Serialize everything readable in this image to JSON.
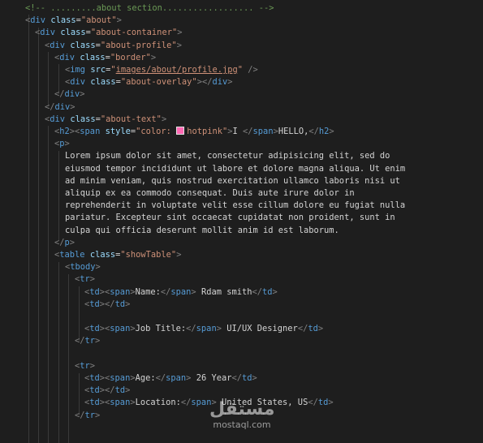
{
  "editor": {
    "lines": [
      [
        {
          "t": "<!-- .........about section.................. -->",
          "c": "comment"
        }
      ],
      [
        {
          "t": "<",
          "c": "punc"
        },
        {
          "t": "div",
          "c": "tag"
        },
        {
          "t": " "
        },
        {
          "t": "class",
          "c": "attr"
        },
        {
          "t": "=",
          "c": "text"
        },
        {
          "t": "\"about\"",
          "c": "str"
        },
        {
          "t": ">",
          "c": "punc"
        }
      ],
      [
        {
          "t": "<",
          "c": "punc"
        },
        {
          "t": "div",
          "c": "tag"
        },
        {
          "t": " "
        },
        {
          "t": "class",
          "c": "attr"
        },
        {
          "t": "=",
          "c": "text"
        },
        {
          "t": "\"about-container\"",
          "c": "str"
        },
        {
          "t": ">",
          "c": "punc"
        }
      ],
      [
        {
          "t": "<",
          "c": "punc"
        },
        {
          "t": "div",
          "c": "tag"
        },
        {
          "t": " "
        },
        {
          "t": "class",
          "c": "attr"
        },
        {
          "t": "=",
          "c": "text"
        },
        {
          "t": "\"about-profile\"",
          "c": "str"
        },
        {
          "t": ">",
          "c": "punc"
        }
      ],
      [
        {
          "t": "<",
          "c": "punc"
        },
        {
          "t": "div",
          "c": "tag"
        },
        {
          "t": " "
        },
        {
          "t": "class",
          "c": "attr"
        },
        {
          "t": "=",
          "c": "text"
        },
        {
          "t": "\"border\"",
          "c": "str"
        },
        {
          "t": ">",
          "c": "punc"
        }
      ],
      [
        {
          "t": "<",
          "c": "punc"
        },
        {
          "t": "img",
          "c": "tag"
        },
        {
          "t": " "
        },
        {
          "t": "src",
          "c": "attr"
        },
        {
          "t": "=",
          "c": "text"
        },
        {
          "t": "\"",
          "c": "str"
        },
        {
          "t": "images/about/profile.jpg",
          "c": "str",
          "u": true
        },
        {
          "t": "\"",
          "c": "str"
        },
        {
          "t": " "
        },
        {
          "t": "/>",
          "c": "punc"
        }
      ],
      [
        {
          "t": "<",
          "c": "punc"
        },
        {
          "t": "div",
          "c": "tag"
        },
        {
          "t": " "
        },
        {
          "t": "class",
          "c": "attr"
        },
        {
          "t": "=",
          "c": "text"
        },
        {
          "t": "\"about-overlay\"",
          "c": "str"
        },
        {
          "t": "></",
          "c": "punc"
        },
        {
          "t": "div",
          "c": "tag"
        },
        {
          "t": ">",
          "c": "punc"
        }
      ],
      [
        {
          "t": "</",
          "c": "punc"
        },
        {
          "t": "div",
          "c": "tag"
        },
        {
          "t": ">",
          "c": "punc"
        }
      ],
      [
        {
          "t": "</",
          "c": "punc"
        },
        {
          "t": "div",
          "c": "tag"
        },
        {
          "t": ">",
          "c": "punc"
        }
      ],
      [
        {
          "t": "<",
          "c": "punc"
        },
        {
          "t": "div",
          "c": "tag"
        },
        {
          "t": " "
        },
        {
          "t": "class",
          "c": "attr"
        },
        {
          "t": "=",
          "c": "text"
        },
        {
          "t": "\"about-text\"",
          "c": "str"
        },
        {
          "t": ">",
          "c": "punc"
        }
      ],
      [
        {
          "t": "<",
          "c": "punc"
        },
        {
          "t": "h2",
          "c": "tag"
        },
        {
          "t": "><",
          "c": "punc"
        },
        {
          "t": "span",
          "c": "tag"
        },
        {
          "t": " "
        },
        {
          "t": "style",
          "c": "attr"
        },
        {
          "t": "=",
          "c": "text"
        },
        {
          "t": "\"color: ",
          "c": "str"
        },
        {
          "t": "hotpink",
          "c": "str",
          "sw": "#ff69b4"
        },
        {
          "t": "\"",
          "c": "str"
        },
        {
          "t": ">",
          "c": "punc"
        },
        {
          "t": "I ",
          "c": "text"
        },
        {
          "t": "</",
          "c": "punc"
        },
        {
          "t": "span",
          "c": "tag"
        },
        {
          "t": ">",
          "c": "punc"
        },
        {
          "t": "HELLO,",
          "c": "text"
        },
        {
          "t": "</",
          "c": "punc"
        },
        {
          "t": "h2",
          "c": "tag"
        },
        {
          "t": ">",
          "c": "punc"
        }
      ],
      [
        {
          "t": "<",
          "c": "punc"
        },
        {
          "t": "p",
          "c": "tag"
        },
        {
          "t": ">",
          "c": "punc"
        }
      ],
      [
        {
          "t": "Lorem ipsum dolor sit amet, consectetur adipisicing elit, sed do",
          "c": "text"
        }
      ],
      [
        {
          "t": "eiusmod tempor incididunt ut labore et dolore magna aliqua. Ut enim",
          "c": "text"
        }
      ],
      [
        {
          "t": "ad minim veniam, quis nostrud exercitation ullamco laboris nisi ut",
          "c": "text"
        }
      ],
      [
        {
          "t": "aliquip ex ea commodo consequat. Duis aute irure dolor in",
          "c": "text"
        }
      ],
      [
        {
          "t": "reprehenderit in voluptate velit esse cillum dolore eu fugiat nulla",
          "c": "text"
        }
      ],
      [
        {
          "t": "pariatur. Excepteur sint occaecat cupidatat non proident, sunt in",
          "c": "text"
        }
      ],
      [
        {
          "t": "culpa qui officia deserunt mollit anim id est laborum.",
          "c": "text"
        }
      ],
      [
        {
          "t": "</",
          "c": "punc"
        },
        {
          "t": "p",
          "c": "tag"
        },
        {
          "t": ">",
          "c": "punc"
        }
      ],
      [
        {
          "t": "<",
          "c": "punc"
        },
        {
          "t": "table",
          "c": "tag"
        },
        {
          "t": " "
        },
        {
          "t": "class",
          "c": "attr"
        },
        {
          "t": "=",
          "c": "text"
        },
        {
          "t": "\"showTable\"",
          "c": "str"
        },
        {
          "t": ">",
          "c": "punc"
        }
      ],
      [
        {
          "t": "<",
          "c": "punc"
        },
        {
          "t": "tbody",
          "c": "tag"
        },
        {
          "t": ">",
          "c": "punc"
        }
      ],
      [
        {
          "t": "<",
          "c": "punc"
        },
        {
          "t": "tr",
          "c": "tag"
        },
        {
          "t": ">",
          "c": "punc"
        }
      ],
      [
        {
          "t": "<",
          "c": "punc"
        },
        {
          "t": "td",
          "c": "tag"
        },
        {
          "t": "><",
          "c": "punc"
        },
        {
          "t": "span",
          "c": "tag"
        },
        {
          "t": ">",
          "c": "punc"
        },
        {
          "t": "Name:",
          "c": "text"
        },
        {
          "t": "</",
          "c": "punc"
        },
        {
          "t": "span",
          "c": "tag"
        },
        {
          "t": ">",
          "c": "punc"
        },
        {
          "t": " Rdam smith",
          "c": "text"
        },
        {
          "t": "</",
          "c": "punc"
        },
        {
          "t": "td",
          "c": "tag"
        },
        {
          "t": ">",
          "c": "punc"
        }
      ],
      [
        {
          "t": "<",
          "c": "punc"
        },
        {
          "t": "td",
          "c": "tag"
        },
        {
          "t": "></",
          "c": "punc"
        },
        {
          "t": "td",
          "c": "tag"
        },
        {
          "t": ">",
          "c": "punc"
        }
      ],
      [],
      [
        {
          "t": "<",
          "c": "punc"
        },
        {
          "t": "td",
          "c": "tag"
        },
        {
          "t": "><",
          "c": "punc"
        },
        {
          "t": "span",
          "c": "tag"
        },
        {
          "t": ">",
          "c": "punc"
        },
        {
          "t": "Job Title:",
          "c": "text"
        },
        {
          "t": "</",
          "c": "punc"
        },
        {
          "t": "span",
          "c": "tag"
        },
        {
          "t": ">",
          "c": "punc"
        },
        {
          "t": " UI/UX Designer",
          "c": "text"
        },
        {
          "t": "</",
          "c": "punc"
        },
        {
          "t": "td",
          "c": "tag"
        },
        {
          "t": ">",
          "c": "punc"
        }
      ],
      [
        {
          "t": "</",
          "c": "punc"
        },
        {
          "t": "tr",
          "c": "tag"
        },
        {
          "t": ">",
          "c": "punc"
        }
      ],
      [],
      [
        {
          "t": "<",
          "c": "punc"
        },
        {
          "t": "tr",
          "c": "tag"
        },
        {
          "t": ">",
          "c": "punc"
        }
      ],
      [
        {
          "t": "<",
          "c": "punc"
        },
        {
          "t": "td",
          "c": "tag"
        },
        {
          "t": "><",
          "c": "punc"
        },
        {
          "t": "span",
          "c": "tag"
        },
        {
          "t": ">",
          "c": "punc"
        },
        {
          "t": "Age:",
          "c": "text"
        },
        {
          "t": "</",
          "c": "punc"
        },
        {
          "t": "span",
          "c": "tag"
        },
        {
          "t": ">",
          "c": "punc"
        },
        {
          "t": " 26 Year",
          "c": "text"
        },
        {
          "t": "</",
          "c": "punc"
        },
        {
          "t": "td",
          "c": "tag"
        },
        {
          "t": ">",
          "c": "punc"
        }
      ],
      [
        {
          "t": "<",
          "c": "punc"
        },
        {
          "t": "td",
          "c": "tag"
        },
        {
          "t": "></",
          "c": "punc"
        },
        {
          "t": "td",
          "c": "tag"
        },
        {
          "t": ">",
          "c": "punc"
        }
      ],
      [
        {
          "t": "<",
          "c": "punc"
        },
        {
          "t": "td",
          "c": "tag"
        },
        {
          "t": "><",
          "c": "punc"
        },
        {
          "t": "span",
          "c": "tag"
        },
        {
          "t": ">",
          "c": "punc"
        },
        {
          "t": "Location:",
          "c": "text"
        },
        {
          "t": "</",
          "c": "punc"
        },
        {
          "t": "span",
          "c": "tag"
        },
        {
          "t": ">",
          "c": "punc"
        },
        {
          "t": " United States, US",
          "c": "text"
        },
        {
          "t": "</",
          "c": "punc"
        },
        {
          "t": "td",
          "c": "tag"
        },
        {
          "t": ">",
          "c": "punc"
        }
      ],
      [
        {
          "t": "</",
          "c": "punc"
        },
        {
          "t": "tr",
          "c": "tag"
        },
        {
          "t": ">",
          "c": "punc"
        }
      ]
    ]
  },
  "watermark": {
    "logo_text": "مستقل",
    "url": "mostaql.com"
  },
  "colors": {
    "background": "#1e1e1e",
    "comment": "#6a9955",
    "punctuation": "#808080",
    "tag": "#569cd6",
    "attribute": "#9cdcfe",
    "string": "#ce9178",
    "text": "#d4d4d4",
    "hotpink_swatch": "#ff69b4"
  }
}
